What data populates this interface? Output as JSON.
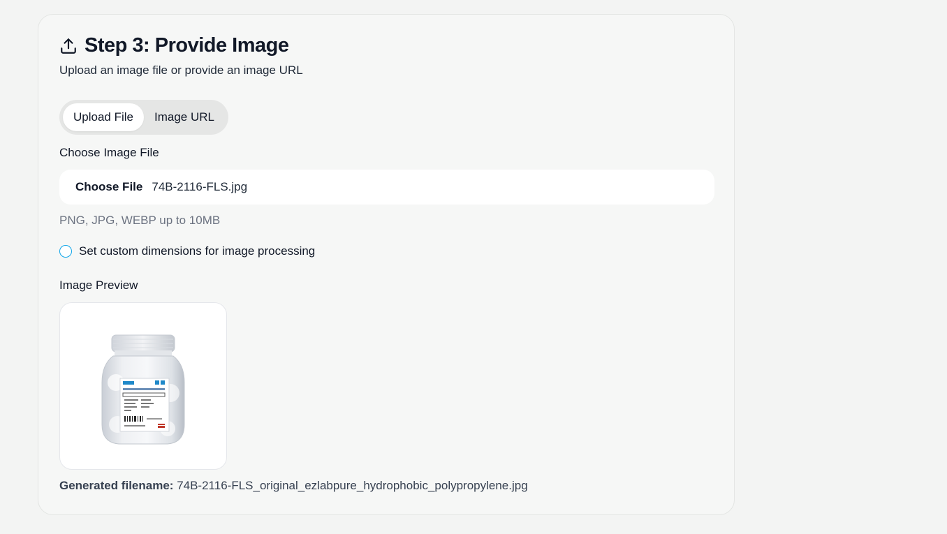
{
  "step": {
    "title": "Step 3: Provide Image",
    "subtitle": "Upload an image file or provide an image URL",
    "icon": "upload-icon"
  },
  "tabs": [
    {
      "label": "Upload File",
      "active": true
    },
    {
      "label": "Image URL",
      "active": false
    }
  ],
  "file_field": {
    "label": "Choose Image File",
    "button_label": "Choose File",
    "file_name": "74B-2116-FLS.jpg",
    "hint": "PNG, JPG, WEBP up to 10MB"
  },
  "custom_dimensions": {
    "label": "Set custom dimensions for image processing",
    "checked": false
  },
  "preview": {
    "label": "Image Preview"
  },
  "generated_filename": {
    "label": "Generated filename:",
    "value": "74B-2116-FLS_original_ezlabpure_hydrophobic_polypropylene.jpg"
  },
  "colors": {
    "accent": "#0ea5e9",
    "card_bg": "#f6f7f6",
    "muted_text": "#6b7280"
  }
}
